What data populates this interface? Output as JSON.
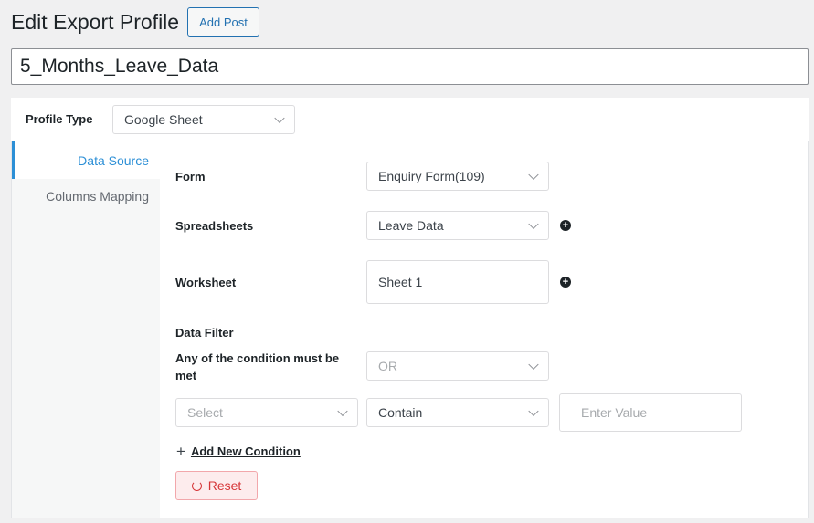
{
  "header": {
    "title": "Edit Export Profile",
    "add_post_label": "Add Post"
  },
  "profile_title": "5_Months_Leave_Data",
  "profile_type": {
    "label": "Profile Type",
    "value": "Google Sheet"
  },
  "sidebar": {
    "items": [
      {
        "label": "Data Source",
        "active": true
      },
      {
        "label": "Columns Mapping",
        "active": false
      }
    ]
  },
  "form": {
    "form_label": "Form",
    "form_value": "Enquiry Form(109)",
    "spreadsheets_label": "Spreadsheets",
    "spreadsheets_value": "Leave Data",
    "worksheet_label": "Worksheet",
    "worksheet_value": "Sheet 1",
    "data_filter_label": "Data Filter",
    "condition_label": "Any of the condition must be met",
    "condition_value": "OR",
    "filter_field_placeholder": "Select",
    "filter_operator_value": "Contain",
    "filter_value_placeholder": "Enter Value",
    "add_condition_label": "Add New Condition",
    "reset_label": "Reset"
  },
  "colors": {
    "accent": "#2c8fd6",
    "reset_red": "#d63638",
    "button_blue": "#2271b1"
  }
}
